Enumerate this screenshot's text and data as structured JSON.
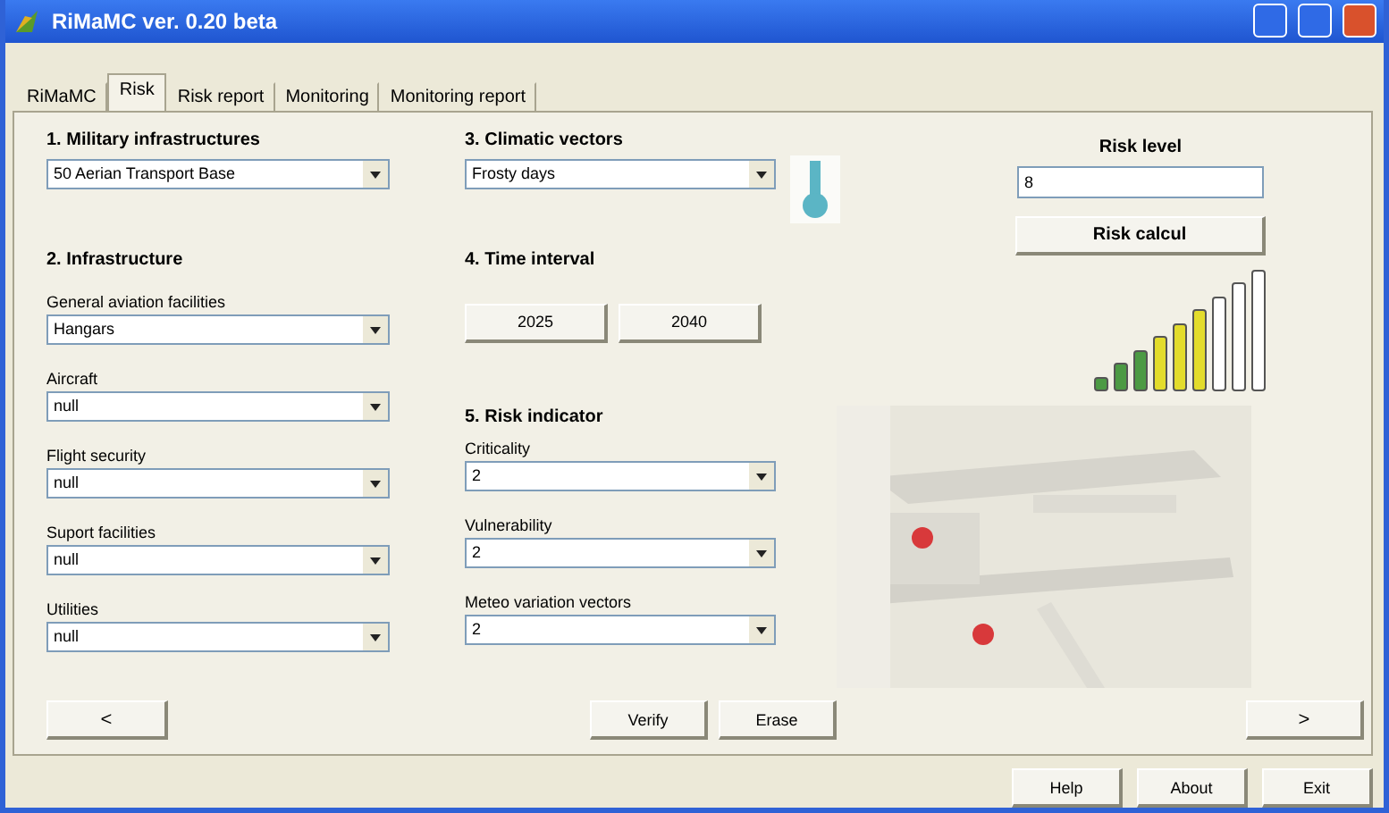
{
  "window": {
    "title": "RiMaMC ver. 0.20 beta"
  },
  "tabs": [
    {
      "label": "RiMaMC",
      "selected": false
    },
    {
      "label": "Risk",
      "selected": true
    },
    {
      "label": "Risk report",
      "selected": false
    },
    {
      "label": "Monitoring",
      "selected": false
    },
    {
      "label": "Monitoring report",
      "selected": false
    }
  ],
  "military": {
    "title": "1. Military infrastructures",
    "value": "50 Aerian Transport Base"
  },
  "infrastructure": {
    "title": "2. Infrastructure",
    "fields": [
      {
        "label": "General aviation facilities",
        "value": "Hangars"
      },
      {
        "label": "Aircraft",
        "value": "null"
      },
      {
        "label": "Flight security",
        "value": "null"
      },
      {
        "label": "Suport facilities",
        "value": "null"
      },
      {
        "label": "Utilities",
        "value": "null"
      }
    ]
  },
  "climatic": {
    "title": "3. Climatic vectors",
    "value": "Frosty days"
  },
  "time_interval": {
    "title": "4. Time interval",
    "buttons": [
      "2025",
      "2040"
    ]
  },
  "risk_indicator": {
    "title": "5. Risk indicator",
    "fields": [
      {
        "label": "Criticality",
        "value": "2"
      },
      {
        "label": "Vulnerability",
        "value": "2"
      },
      {
        "label": "Meteo variation vectors",
        "value": "2"
      }
    ]
  },
  "risk": {
    "title": "Risk level",
    "value": "8",
    "button": "Risk calcul",
    "bars": [
      {
        "color": "#4c9a44"
      },
      {
        "color": "#4c9a44"
      },
      {
        "color": "#4c9a44"
      },
      {
        "color": "#e3dc2c"
      },
      {
        "color": "#e3dc2c"
      },
      {
        "color": "#e3dc2c"
      },
      {
        "color": "#ffffff"
      },
      {
        "color": "#ffffff"
      },
      {
        "color": "#ffffff"
      }
    ]
  },
  "nav": {
    "prev": "<",
    "actions": [
      "Verify",
      "Erase"
    ],
    "next": ">"
  },
  "footer": [
    "Help",
    "About",
    "Exit"
  ]
}
